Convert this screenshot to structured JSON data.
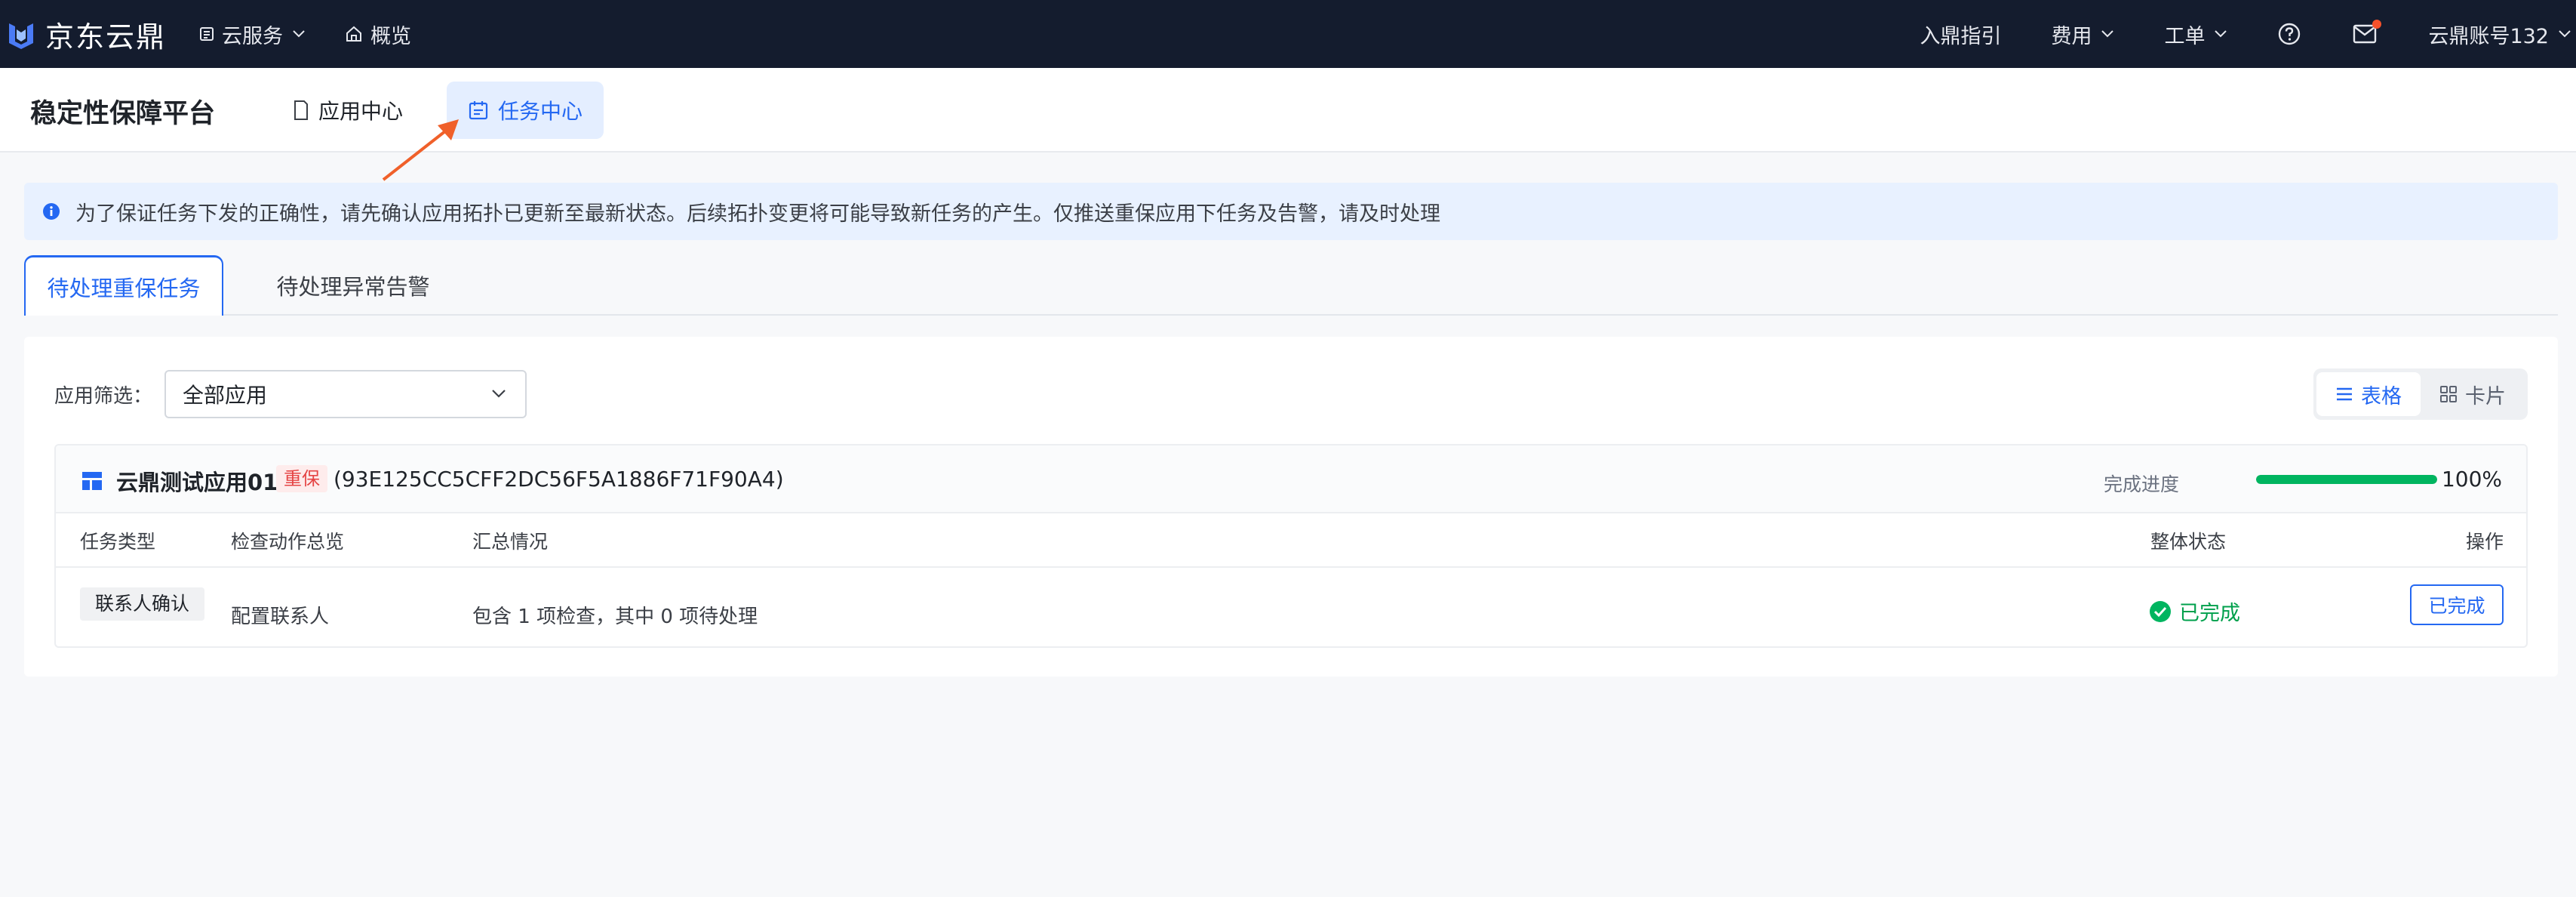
{
  "topnav": {
    "brand": "京东云鼎",
    "cloud_services": "云服务",
    "overview": "概览",
    "guide": "入鼎指引",
    "fees": "费用",
    "tickets": "工单",
    "account": "云鼎账号132"
  },
  "subhead": {
    "title": "稳定性保障平台",
    "tabs": [
      "应用中心",
      "任务中心"
    ]
  },
  "notice": {
    "text": "为了保证任务下发的正确性，请先确认应用拓扑已更新至最新状态。后续拓扑变更将可能导致新任务的产生。仅推送重保应用下任务及告警，请及时处理"
  },
  "tabs": [
    "待处理重保任务",
    "待处理异常告警"
  ],
  "filter": {
    "label": "应用筛选：",
    "value": "全部应用"
  },
  "view_toggle": {
    "table": "表格",
    "card": "卡片"
  },
  "app": {
    "name": "云鼎测试应用01",
    "badge": "重保",
    "id": "(93E125CC5CFF2DC56F5A1886F71F90A4)",
    "progress_label": "完成进度",
    "progress_text": "100%",
    "progress_value": 1.0
  },
  "table": {
    "columns": [
      "任务类型",
      "检查动作总览",
      "汇总情况",
      "整体状态",
      "操作"
    ],
    "rows": [
      {
        "type": "联系人确认",
        "action": "配置联系人",
        "summary": "包含 1 项检查，其中 0 项待处理",
        "status": "已完成",
        "op": "已完成"
      }
    ]
  },
  "colors": {
    "nav_bg": "#141c2e",
    "accent": "#2468f2",
    "success": "#00b560",
    "danger": "#e54545",
    "annotation_arrow": "#f0602a"
  }
}
